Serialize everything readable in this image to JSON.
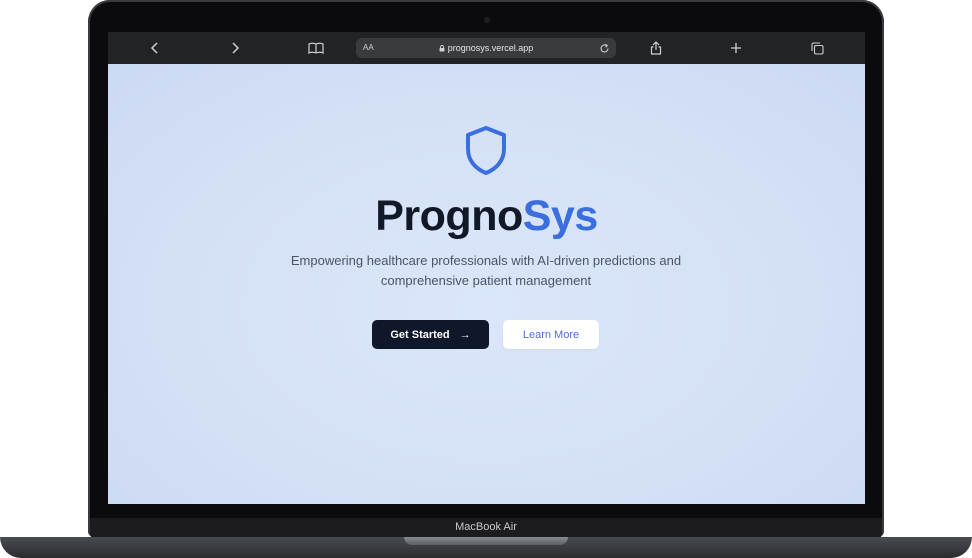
{
  "device": {
    "label": "MacBook Air"
  },
  "browser": {
    "url": "prognosys.vercel.app",
    "text_size_label": "AA",
    "icons": [
      "back-icon",
      "forward-icon",
      "bookmarks-icon",
      "lock-icon",
      "reload-icon",
      "share-icon",
      "new-tab-icon",
      "tabs-icon"
    ]
  },
  "hero": {
    "title_part1": "Progno",
    "title_part2": "Sys",
    "subtitle": "Empowering healthcare professionals with AI-driven predictions and comprehensive patient management",
    "primary_button": "Get Started",
    "primary_button_icon": "→",
    "secondary_button": "Learn More"
  },
  "colors": {
    "accent": "#3b6fe0",
    "dark": "#0f172a",
    "page_bg": "#d6e2f8"
  }
}
